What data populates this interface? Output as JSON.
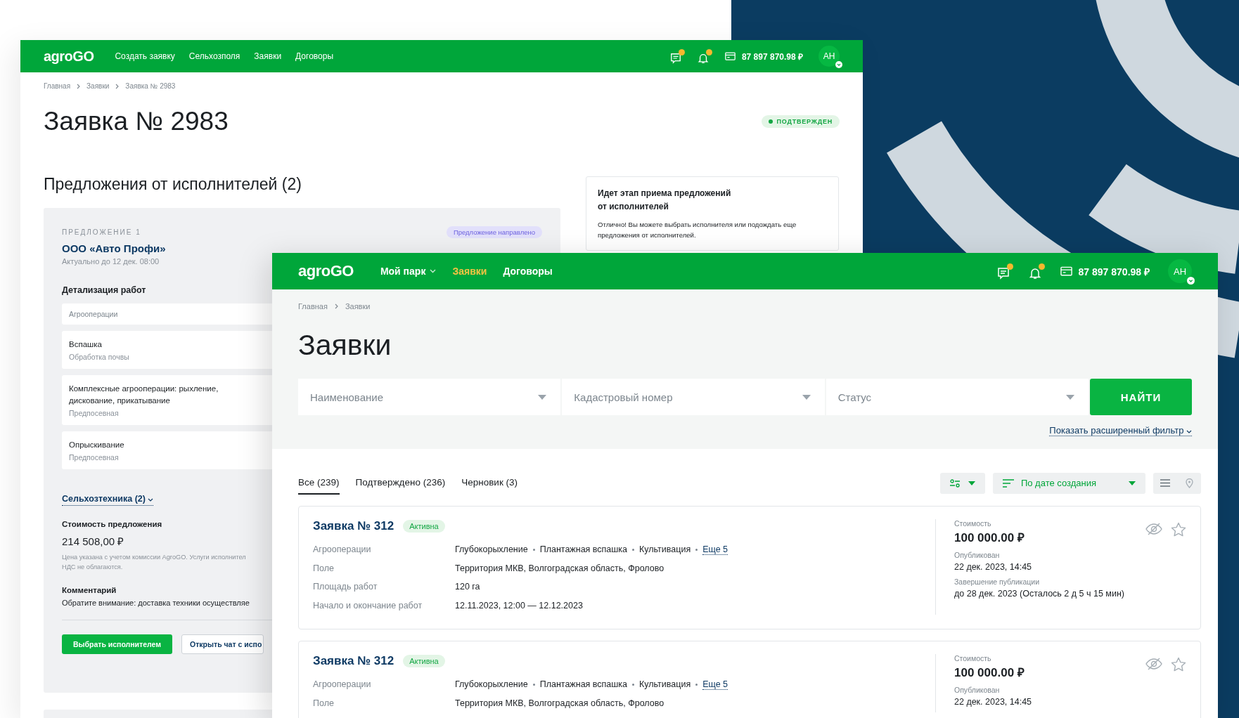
{
  "back_window": {
    "header": {
      "logo": "agroGO",
      "nav": [
        {
          "label": "Создать заявку",
          "selected": false,
          "dropdown": false
        },
        {
          "label": "Сельхозполя",
          "selected": false,
          "dropdown": false
        },
        {
          "label": "Заявки",
          "selected": false,
          "dropdown": false
        },
        {
          "label": "Договоры",
          "selected": false,
          "dropdown": false
        }
      ],
      "indicators": [
        {
          "kind": "chat",
          "unread": true
        },
        {
          "kind": "bell",
          "unread": true
        }
      ],
      "balance": "87 897 870.98 ₽",
      "avatar": "АН"
    },
    "breadcrumbs": [
      "Главная",
      "Заявки",
      "Заявка № 2983"
    ],
    "title": "Заявка № 2983",
    "status": "ПОДТВЕРЖДЕН",
    "offers_heading": "Предложения от исполнителей (2)",
    "offer": {
      "label": "ПРЕДЛОЖЕНИЕ 1",
      "badge": "Предложение направлено",
      "company": "ООО «Авто Профи»",
      "valid_until": "Актуально до 12 дек. 08:00",
      "details_heading": "Детализация работ",
      "operations_header": "Агрооперации",
      "operations": [
        {
          "name": "Вспашка",
          "category": "Обработка почвы"
        },
        {
          "name": "Комплексные агрооперации: рыхление, дискование, прикатывание",
          "category": "Предпосевная"
        },
        {
          "name": "Опрыскивание",
          "category": "Предпосевная"
        }
      ],
      "machinery_link": "Сельхозтехника (2)",
      "price_label": "Стоимость предложения",
      "price": "214 508,00 ₽",
      "price_note": [
        "Цена указана с учетом комиссии AgroGO. Услуги исполнител",
        "НДС не облагаются."
      ],
      "comment_label": "Комментарий",
      "comment": "Обратите внимание: доставка техники осуществляе",
      "buttons": [
        {
          "label": "Выбрать исполнителем",
          "kind": "primary"
        },
        {
          "label": "Открыть чат с испо",
          "kind": "secondary"
        }
      ]
    },
    "info_card": {
      "title": "Идет этап приема предложений от исполнителей",
      "text": "Отлично! Вы можете выбрать исполнителя или подождать еще предложения от исполнителей."
    }
  },
  "front_window": {
    "header": {
      "logo": "agroGO",
      "nav": [
        {
          "label": "Мой парк",
          "selected": false,
          "dropdown": true
        },
        {
          "label": "Заявки",
          "selected": true,
          "dropdown": false
        },
        {
          "label": "Договоры",
          "selected": false,
          "dropdown": false
        }
      ],
      "indicators": [
        {
          "kind": "chat",
          "unread": true
        },
        {
          "kind": "bell",
          "unread": true
        }
      ],
      "balance": "87 897 870.98 ₽",
      "avatar": "АН"
    },
    "breadcrumbs": [
      "Главная",
      "Заявки"
    ],
    "title": "Заявки",
    "filters": [
      {
        "placeholder": "Наименование"
      },
      {
        "placeholder": "Кадастровый номер"
      },
      {
        "placeholder": "Статус"
      }
    ],
    "search_button": "НАЙТИ",
    "advanced_filter_link": "Показать расширенный фильтр",
    "tabs": [
      {
        "label": "Все (239)",
        "selected": true
      },
      {
        "label": "Подтверждено (236)",
        "selected": false
      },
      {
        "label": "Черновик (3)",
        "selected": false
      }
    ],
    "sort": "По дате создания",
    "views": [
      {
        "kind": "list",
        "selected": true
      },
      {
        "kind": "map",
        "selected": false
      }
    ],
    "requests": [
      {
        "title": "Заявка № 312",
        "status": "Активна",
        "hidden": true,
        "favorite": false,
        "fields": [
          {
            "kind": "tags",
            "label": "Агрооперации",
            "items": [
              "Глубокорыхление",
              "Плантажная вспашка",
              "Культивация"
            ],
            "more": "Еще 5"
          },
          {
            "kind": "text",
            "label": "Поле",
            "value": "Территория МКВ, Волгоградская область, Фролово"
          },
          {
            "kind": "text",
            "label": "Площадь работ",
            "value": "120 га"
          },
          {
            "kind": "text",
            "label": "Начало и окончание работ",
            "value": "12.11.2023, 12:00 — 12.12.2023"
          }
        ],
        "meta": [
          {
            "kind": "price",
            "label": "Стоимость",
            "value": "100 000.00 ₽"
          },
          {
            "kind": "text",
            "label": "Опубликован",
            "value": "22 дек. 2023, 14:45"
          },
          {
            "kind": "text",
            "label": "Завершение публикации",
            "value": "до 28 дек. 2023 (Осталось 2 д 5 ч 15 мин)"
          }
        ]
      },
      {
        "title": "Заявка № 312",
        "status": "Активна",
        "hidden": true,
        "favorite": false,
        "fields": [
          {
            "kind": "tags",
            "label": "Агрооперации",
            "items": [
              "Глубокорыхление",
              "Плантажная вспашка",
              "Культивация"
            ],
            "more": "Еще 5"
          },
          {
            "kind": "text",
            "label": "Поле",
            "value": "Территория МКВ, Волгоградская область, Фролово"
          }
        ],
        "meta": [
          {
            "kind": "price",
            "label": "Стоимость",
            "value": "100 000.00 ₽"
          },
          {
            "kind": "text",
            "label": "Опубликован",
            "value": "22 дек. 2023, 14:45"
          }
        ]
      }
    ]
  }
}
